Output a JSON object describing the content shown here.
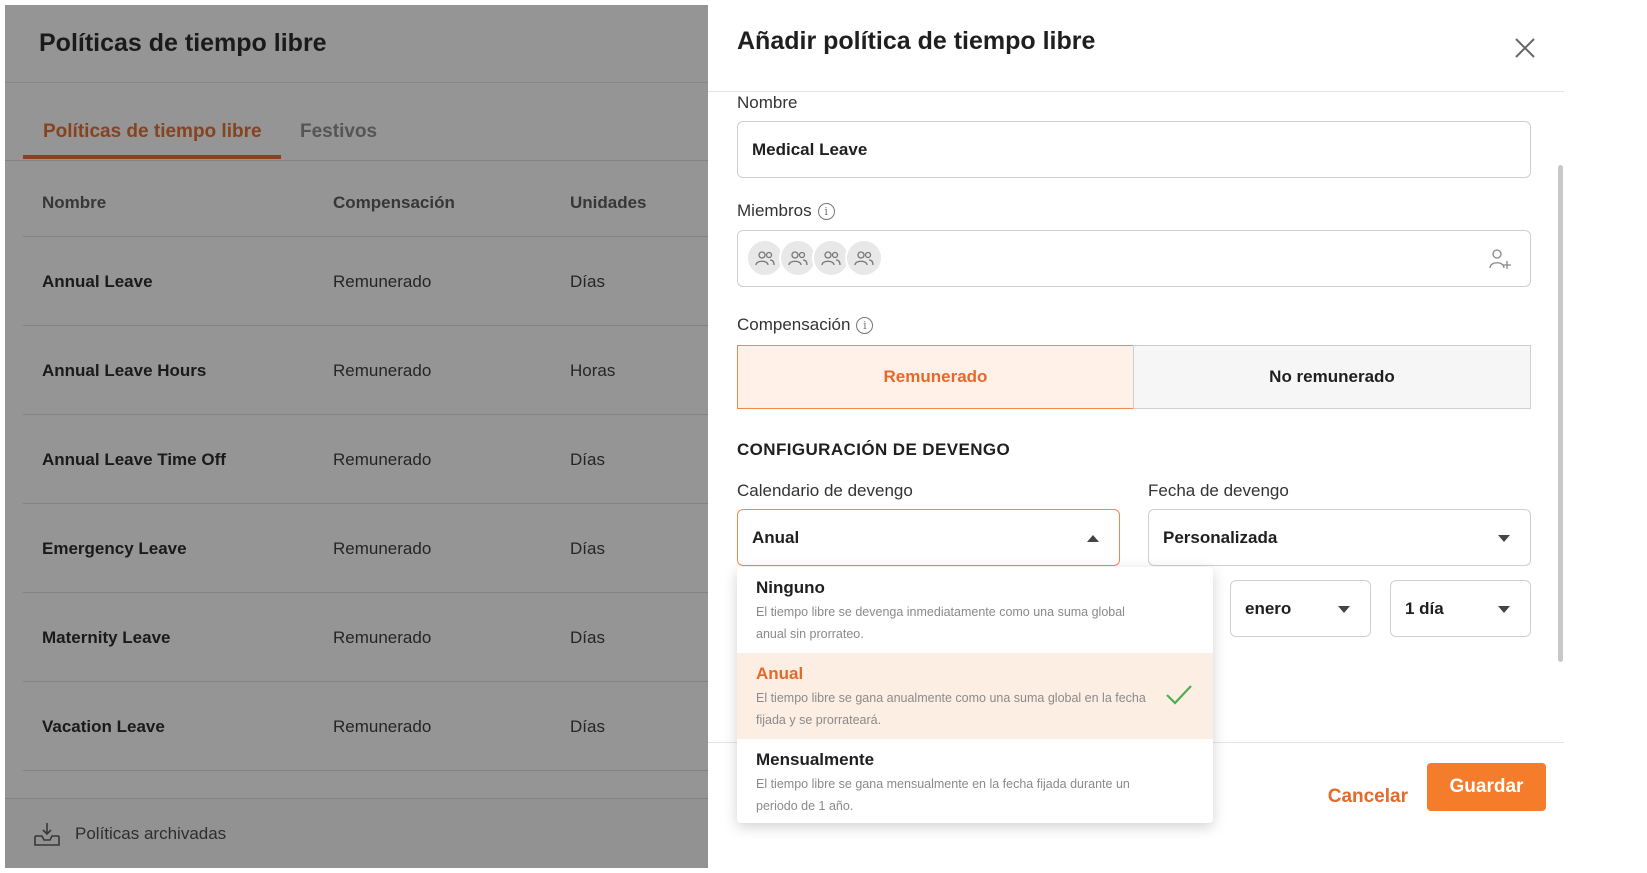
{
  "background": {
    "title": "Políticas de tiempo libre",
    "tabs": [
      {
        "label": "Políticas de tiempo libre",
        "active": true
      },
      {
        "label": "Festivos",
        "active": false
      }
    ],
    "table": {
      "headers": [
        "Nombre",
        "Compensación",
        "Unidades"
      ],
      "rows": [
        {
          "name": "Annual Leave",
          "compensation": "Remunerado",
          "units": "Días"
        },
        {
          "name": "Annual Leave Hours",
          "compensation": "Remunerado",
          "units": "Horas"
        },
        {
          "name": "Annual Leave Time Off",
          "compensation": "Remunerado",
          "units": "Días"
        },
        {
          "name": "Emergency Leave",
          "compensation": "Remunerado",
          "units": "Días"
        },
        {
          "name": "Maternity Leave",
          "compensation": "Remunerado",
          "units": "Días"
        },
        {
          "name": "Vacation Leave",
          "compensation": "Remunerado",
          "units": "Días"
        }
      ]
    },
    "footer": {
      "archived_label": "Políticas archivadas",
      "icon": "inbox-tray-icon"
    }
  },
  "drawer": {
    "title": "Añadir política de tiempo libre",
    "close_icon": "close-icon",
    "name_label": "Nombre",
    "name_value": "Medical Leave",
    "members_label": "Miembros",
    "members_icon": "users-icon",
    "add_member_icon": "add-user-icon",
    "compensation_label": "Compensación",
    "compensation_options": [
      {
        "label": "Remunerado",
        "selected": true
      },
      {
        "label": "No remunerado",
        "selected": false
      }
    ],
    "accrual_section_title": "CONFIGURACIÓN DE DEVENGO",
    "accrual_schedule_label": "Calendario de devengo",
    "accrual_schedule_value": "Anual",
    "accrual_date_label": "Fecha de devengo",
    "accrual_date_value": "Personalizada",
    "month_value": "enero",
    "day_value": "1 día",
    "cancel_label": "Cancelar",
    "save_label": "Guardar"
  },
  "dropdown": {
    "options": [
      {
        "title": "Ninguno",
        "desc": "El tiempo libre se devenga inmediatamente como una suma global anual sin prorrateo.",
        "selected": false
      },
      {
        "title": "Anual",
        "desc": "El tiempo libre se gana anualmente como una suma global en la fecha fijada y se prorrateará.",
        "selected": true
      },
      {
        "title": "Mensualmente",
        "desc": "El tiempo libre se gana mensualmente en la fecha fijada durante un periodo de 1 año.",
        "selected": false
      }
    ]
  },
  "colors": {
    "accent": "#e5692b",
    "button": "#f57c2b",
    "selected_bg": "#fdeee4",
    "check": "#4caf50"
  }
}
